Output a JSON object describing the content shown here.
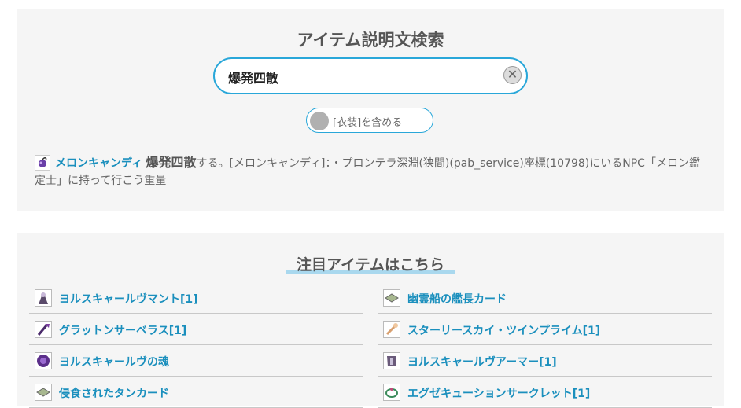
{
  "search": {
    "title": "アイテム説明文検索",
    "query": "爆発四散",
    "clear_symbol": "✕",
    "costume_toggle_label": "[衣装]を含める"
  },
  "result": {
    "item_name": "メロンキャンディ",
    "keyword": "爆発四散",
    "description": "する。[メロンキャンディ]：・プロンテラ深淵(狭間)(pab_service)座標(10798)にいるNPC「メロン鑑定士」に持って行こう重量"
  },
  "featured": {
    "title": "注目アイテムはこちら",
    "left": [
      {
        "label": "ヨルスキャールヴマント[1]",
        "icon": "cloak-icon"
      },
      {
        "label": "グラットンサーベラス[1]",
        "icon": "weapon-icon"
      },
      {
        "label": "ヨルスキャールヴの魂",
        "icon": "soul-icon"
      },
      {
        "label": "侵食されたタンカード",
        "icon": "card-icon"
      }
    ],
    "right": [
      {
        "label": "幽霊船の艦長カード",
        "icon": "card-icon"
      },
      {
        "label": "スターリースカイ・ツインプライム[1]",
        "icon": "staff-icon"
      },
      {
        "label": "ヨルスキャールヴアーマー[1]",
        "icon": "armor-icon"
      },
      {
        "label": "エグゼキューションサークレット[1]",
        "icon": "circlet-icon"
      }
    ]
  }
}
